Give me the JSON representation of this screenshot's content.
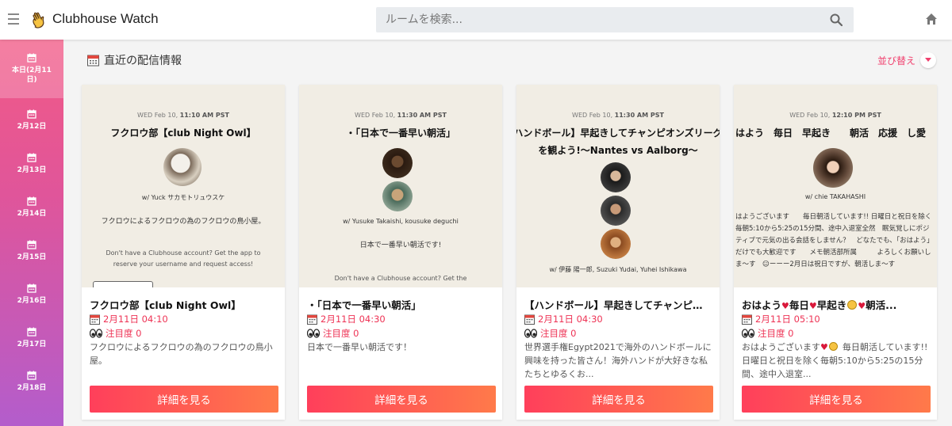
{
  "app": {
    "title": "Clubhouse Watch"
  },
  "search": {
    "placeholder": "ルームを検索..."
  },
  "sidebar": {
    "items": [
      {
        "label": "本日(2月11日)",
        "active": true
      },
      {
        "label": "2月12日"
      },
      {
        "label": "2月13日"
      },
      {
        "label": "2月14日"
      },
      {
        "label": "2月15日"
      },
      {
        "label": "2月16日"
      },
      {
        "label": "2月17日"
      },
      {
        "label": "2月18日"
      }
    ]
  },
  "section": {
    "title": "直近の配信情報",
    "sort_label": "並び替え"
  },
  "cards": [
    {
      "image": {
        "date_prefix": "WED Feb 10, ",
        "date_time": "11:10 AM PST",
        "title": "フクロウ部【club Night Owl】",
        "with": "w/ Yuck サカモトリュウスケ",
        "desc": "フクロウによるフクロウの為のフクロウの鳥小屋。",
        "cta": "Don't have a Clubhouse account? Get the app to reserve your username and request access!"
      },
      "title": "フクロウ部【club Night Owl】",
      "date": "2月11日 04:10",
      "attention": "注目度 0",
      "desc": "フクロウによるフクロウの為のフクロウの鳥小屋。",
      "button": "詳細を見る"
    },
    {
      "image": {
        "date_prefix": "WED Feb 10, ",
        "date_time": "11:30 AM PST",
        "title": "・「日本で一番早い朝活」",
        "with": "w/ Yusuke Takaishi, kousuke deguchi",
        "desc": "日本で一番早い朝活です!",
        "cta": "Don't have a Clubhouse account? Get the"
      },
      "title": "・「日本で一番早い朝活」",
      "date": "2月11日 04:30",
      "attention": "注目度 0",
      "desc": "日本で一番早い朝活です！",
      "button": "詳細を見る"
    },
    {
      "image": {
        "date_prefix": "WED Feb 10, ",
        "date_time": "11:30 AM PST",
        "title": "ハンドボール】早起きしてチャンピオンズリーグを観よう!〜Nantes vs Aalborg〜",
        "with": "w/ 伊藤 陽一郎, Suzuki Yudai, Yuhei Ishikawa",
        "desc": "",
        "cta": ""
      },
      "title": "【ハンドボール】早起きしてチャンピオンズリーグを観よう",
      "date": "2月11日 04:30",
      "attention": "注目度 0",
      "desc": "世界選手権Egypt2021で海外のハンドボールに興味を持った皆さん！海外ハンドが大好きな私たちとゆるくお...",
      "button": "詳細を見る"
    },
    {
      "image": {
        "date_prefix": "WED Feb 10, ",
        "date_time": "12:10 PM PST",
        "title": "はよう　毎日　早起き　　朝活　応援　し愛",
        "with": "w/ chie TAKAHASHI",
        "desc": "はようございます　　毎日朝活しています!! 日曜日と祝日を除く毎朝5:10から5:25の15分間、途中入退室全然　眠気覚しにポジティブで元気の出る会話をしません？　どなたでも、「おはよう」だけでも大歓迎です　　メモ朝活部所属　　　よろしくお願いしま〜す　☺ーーー2月日は祝日ですが、朝活しま〜す",
        "cta": ""
      },
      "title": "おはよう",
      "title_rest": [
        "毎日",
        "早起き",
        "朝活..."
      ],
      "date": "2月11日 05:10",
      "attention": "注目度 0",
      "desc": "おはようございます",
      "desc_rest": "毎日朝活しています!! 日曜日と祝日を除く毎朝5:10から5:25の15分間、途中入退室...",
      "button": "詳細を見る"
    }
  ],
  "colors": {
    "accent": "#ee3355",
    "sidebar_top": "#f25a86",
    "sidebar_bottom": "#b35dcc"
  }
}
